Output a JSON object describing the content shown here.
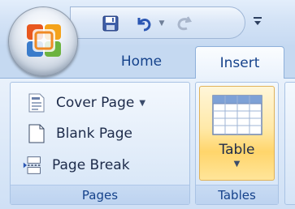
{
  "tabs": {
    "home": "Home",
    "insert": "Insert"
  },
  "groups": {
    "pages": {
      "label": "Pages",
      "items": {
        "cover": "Cover Page",
        "blank": "Blank Page",
        "break": "Page Break"
      }
    },
    "tables": {
      "label": "Tables",
      "table_button": "Table"
    }
  },
  "icons": {
    "office_button": "office-logo-icon",
    "save": "save-icon",
    "undo": "undo-icon",
    "redo": "redo-icon",
    "customize": "customize-qat-icon"
  },
  "colors": {
    "accent": "#15428b",
    "highlight": "#ffd56b"
  }
}
